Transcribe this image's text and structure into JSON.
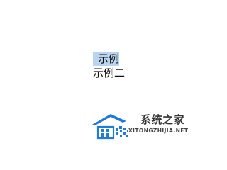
{
  "document": {
    "lines": [
      "示例",
      "示例二"
    ]
  },
  "watermark": {
    "brand_cn": "系统之家",
    "brand_en": "XITONGZHIJIA.NET"
  },
  "colors": {
    "selection": "#b9d4ee",
    "logo_blue": "#1e7bd6"
  }
}
